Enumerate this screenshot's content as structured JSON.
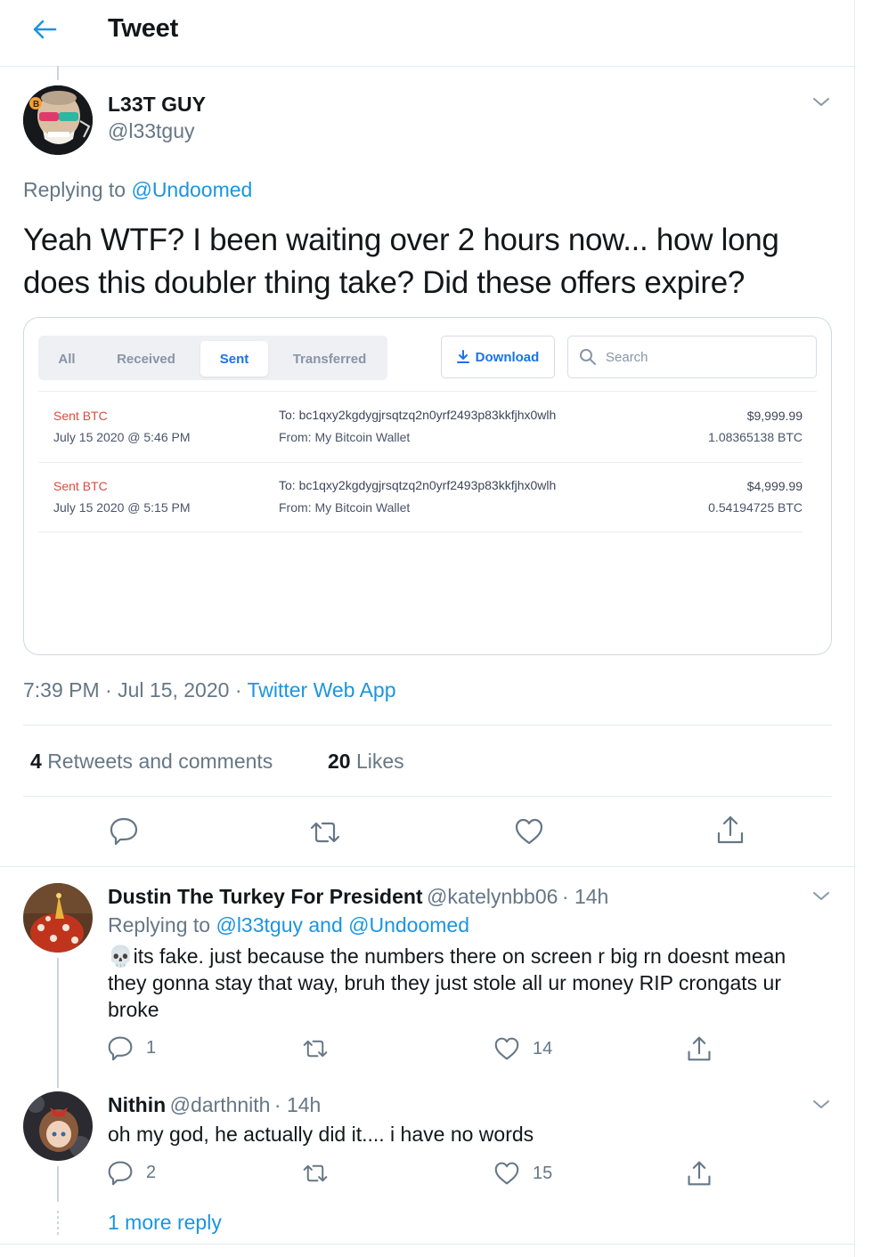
{
  "header": {
    "title": "Tweet"
  },
  "main_tweet": {
    "name": "L33T GUY",
    "handle": "@l33tguy",
    "replying_prefix": "Replying to",
    "replying_to": "@Undoomed",
    "text": "Yeah WTF? I been waiting over 2 hours now... how long does this doubler thing take? Did these offers expire?",
    "time": "7:39 PM",
    "date": "Jul 15, 2020",
    "source": "Twitter Web App",
    "retweets_count": "4",
    "retweets_label": "Retweets and comments",
    "likes_count": "20",
    "likes_label": "Likes"
  },
  "embedded_image": {
    "tabs": [
      "All",
      "Received",
      "Sent",
      "Transferred"
    ],
    "active_tab": "Sent",
    "download_label": "Download",
    "search_placeholder": "Search",
    "transactions": [
      {
        "type": "Sent BTC",
        "date": "July 15 2020 @ 5:46 PM",
        "to": "To: bc1qxy2kgdygjrsqtzq2n0yrf2493p83kkfjhx0wlh",
        "from": "From: My Bitcoin Wallet",
        "usd": "$9,999.99",
        "btc": "1.08365138 BTC"
      },
      {
        "type": "Sent BTC",
        "date": "July 15 2020 @ 5:15 PM",
        "to": "To: bc1qxy2kgdygjrsqtzq2n0yrf2493p83kkfjhx0wlh",
        "from": "From: My Bitcoin Wallet",
        "usd": "$4,999.99",
        "btc": "0.54194725 BTC"
      }
    ]
  },
  "replies": [
    {
      "name": "Dustin The Turkey For President",
      "handle": "@katelynbb06",
      "time": "· 14h",
      "replying_prefix": "Replying to",
      "replying_to": "@l33tguy and @Undoomed",
      "text": "its fake. just because the numbers there on screen r big rn doesnt mean they gonna stay that way, bruh they just stole all ur money RIP crongats ur broke",
      "emoji": "💀",
      "reply_count": "1",
      "like_count": "14"
    },
    {
      "name": "Nithin",
      "handle": "@darthnith",
      "time": "· 14h",
      "text": "oh my god, he actually did it.... i have no words",
      "reply_count": "2",
      "like_count": "15"
    }
  ],
  "more_replies": "1 more reply",
  "colors": {
    "accent": "#1b95e0",
    "muted": "#657786",
    "border": "#e6ecf0",
    "sent_red": "#d94c3d",
    "wallet_blue": "#1a73e8"
  },
  "icons": [
    "back-arrow-icon",
    "chevron-down-icon",
    "download-icon",
    "search-icon",
    "reply-icon",
    "retweet-icon",
    "like-icon",
    "share-icon"
  ]
}
